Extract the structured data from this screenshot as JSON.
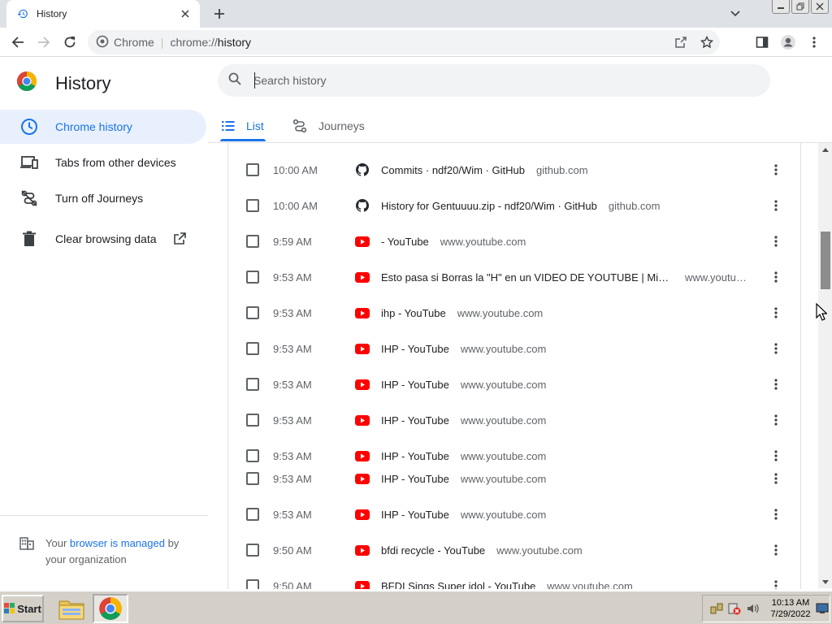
{
  "window": {
    "tab_title": "History",
    "tab_favicon": "history-icon"
  },
  "toolbar": {
    "site_label": "Chrome",
    "url_scheme": "chrome://",
    "url_host": "history"
  },
  "header": {
    "title": "History",
    "search_placeholder": "Search history"
  },
  "sidebar": {
    "items": [
      {
        "label": "Chrome history",
        "icon": "clock-icon"
      },
      {
        "label": "Tabs from other devices",
        "icon": "devices-icon"
      },
      {
        "label": "Turn off Journeys",
        "icon": "journeys-off-icon"
      },
      {
        "label": "Clear browsing data",
        "icon": "trash-icon"
      }
    ],
    "managed": {
      "prefix": "Your ",
      "link": "browser is managed",
      "suffix": " by your organization"
    }
  },
  "view_tabs": {
    "list": "List",
    "journeys": "Journeys"
  },
  "history": {
    "rows": [
      {
        "time": "10:00 AM",
        "title": "Commits · ndf20/Wim · GitHub",
        "domain": "github.com",
        "site": "github"
      },
      {
        "time": "10:00 AM",
        "title": "History for Gentuuuu.zip - ndf20/Wim · GitHub",
        "domain": "github.com",
        "site": "github"
      },
      {
        "time": "9:59 AM",
        "title": " - YouTube",
        "domain": "www.youtube.com",
        "site": "youtube"
      },
      {
        "time": "9:53 AM",
        "title": "Esto pasa si Borras la \"H\" en un VIDEO DE YOUTUBE | Misteri…",
        "domain": "www.youtu…",
        "site": "youtube"
      },
      {
        "time": "9:53 AM",
        "title": "ihp - YouTube",
        "domain": "www.youtube.com",
        "site": "youtube"
      },
      {
        "time": "9:53 AM",
        "title": "IHP - YouTube",
        "domain": "www.youtube.com",
        "site": "youtube"
      },
      {
        "time": "9:53 AM",
        "title": "IHP - YouTube",
        "domain": "www.youtube.com",
        "site": "youtube"
      },
      {
        "time": "9:53 AM",
        "title": "IHP - YouTube",
        "domain": "www.youtube.com",
        "site": "youtube"
      },
      {
        "time": "9:53 AM",
        "title": "IHP - YouTube",
        "domain": "www.youtube.com",
        "site": "youtube"
      },
      {
        "time": "9:53 AM",
        "title": "IHP - YouTube",
        "domain": "www.youtube.com",
        "site": "youtube"
      },
      {
        "time": "9:53 AM",
        "title": "IHP - YouTube",
        "domain": "www.youtube.com",
        "site": "youtube"
      },
      {
        "time": "9:50 AM",
        "title": "bfdi recycle - YouTube",
        "domain": "www.youtube.com",
        "site": "youtube"
      },
      {
        "time": "9:50 AM",
        "title": "BFDI Sings Super idol - YouTube",
        "domain": "www.youtube.com",
        "site": "youtube"
      }
    ]
  },
  "taskbar": {
    "start_label": "Start",
    "clock_time": "10:13 AM",
    "clock_date": "7/29/2022"
  },
  "colors": {
    "accent": "#1a73e8",
    "active_bg": "#e8f0fe",
    "youtube_red": "#ff0000"
  }
}
